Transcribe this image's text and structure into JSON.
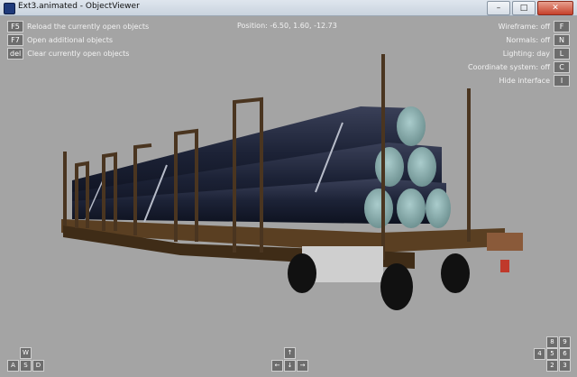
{
  "window": {
    "title": "Ext3.animated - ObjectViewer",
    "controls": {
      "minimize": "–",
      "maximize": "□",
      "close": "✕"
    }
  },
  "hud": {
    "left_menu": [
      {
        "key": "F5",
        "label": "Reload the currently open objects"
      },
      {
        "key": "F7",
        "label": "Open additional objects"
      },
      {
        "key": "del",
        "label": "Clear currently open objects"
      }
    ],
    "position": "Position: -6.50, 1.60, -12.73",
    "right_menu": [
      {
        "key": "F",
        "label": "Wireframe: off"
      },
      {
        "key": "N",
        "label": "Normals: off"
      },
      {
        "key": "L",
        "label": "Lighting: day"
      },
      {
        "key": "C",
        "label": "Coordinate system: off"
      },
      {
        "key": "I",
        "label": "Hide interface"
      }
    ],
    "nav_left": {
      "w": "W",
      "a": "A",
      "s": "S",
      "d": "D"
    },
    "nav_center": {
      "up": "↑",
      "left": "←",
      "down": "↓",
      "right": "→"
    },
    "nav_right": {
      "k8": "8",
      "k9": "9",
      "k4": "4",
      "k5": "5",
      "k6": "6",
      "k2": "2",
      "k3": "3"
    }
  },
  "colors": {
    "viewport_bg": "#a4a4a4",
    "car_body": "#4a3520",
    "pipe": "#1a1f33",
    "pipe_end": "#8fb0b0"
  }
}
